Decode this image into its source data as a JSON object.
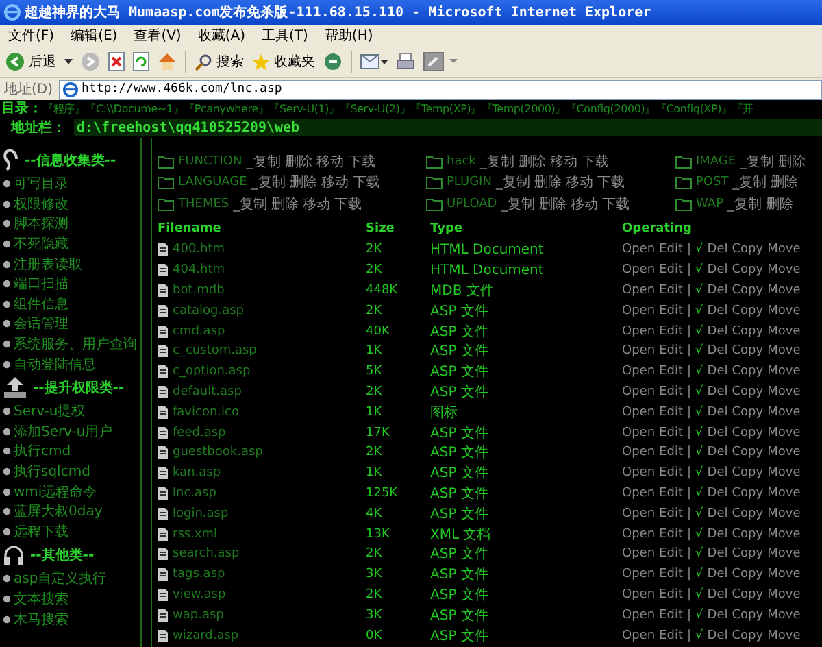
{
  "window": {
    "title": "超越神界的大马 Mumaasp.com发布免杀版-111.68.15.110 - Microsoft Internet Explorer"
  },
  "menu": [
    "文件(F)",
    "编辑(E)",
    "查看(V)",
    "收藏(A)",
    "工具(T)",
    "帮助(H)"
  ],
  "toolbar": {
    "back": "后退",
    "search": "搜索",
    "favorites": "收藏夹"
  },
  "address": {
    "label": "地址(D)",
    "url": "http://www.466k.com/lnc.asp"
  },
  "directory_bar": {
    "label": "目录：",
    "links": [
      "『程序』",
      "『C:\\\\Docume~1』",
      "『Pcanywhere』",
      "『Serv-U(1)』",
      "『Serv-U(2)』",
      "『Temp(XP)』",
      "『Temp(2000)』",
      "『Config(2000)』",
      "『Config(XP)』",
      "『开"
    ]
  },
  "path_bar": {
    "label": "地址栏：",
    "value": "d:\\freehost\\qq410525209\\web"
  },
  "sidebar": [
    {
      "title": "--信息收集类--",
      "items": [
        "可写目录",
        "权限修改",
        "脚本探测",
        "不死隐藏",
        "注册表读取",
        "端口扫描",
        "组件信息",
        "会话管理",
        "系统服务、用户查询",
        "自动登陆信息"
      ]
    },
    {
      "title": "--提升权限类--",
      "items": [
        "Serv-u提权",
        "添加Serv-u用户",
        "执行cmd",
        "执行sqlcmd",
        "wmi远程命令",
        "蓝屏大叔0day",
        "远程下载"
      ]
    },
    {
      "title": "--其他类--",
      "items": [
        "asp自定义执行",
        "文本搜索",
        "木马搜索"
      ]
    }
  ],
  "folders": [
    {
      "name": "FUNCTION",
      "actions": [
        "_复制",
        "删除",
        "移动",
        "下载"
      ]
    },
    {
      "name": "hack",
      "actions": [
        "_复制",
        "删除",
        "移动",
        "下载"
      ]
    },
    {
      "name": "IMAGE",
      "actions": [
        "_复制",
        "删除"
      ]
    },
    {
      "name": "LANGUAGE",
      "actions": [
        "_复制",
        "删除",
        "移动",
        "下载"
      ]
    },
    {
      "name": "PLUGIN",
      "actions": [
        "_复制",
        "删除",
        "移动",
        "下载"
      ]
    },
    {
      "name": "POST",
      "actions": [
        "_复制",
        "删除"
      ]
    },
    {
      "name": "THEMES",
      "actions": [
        "_复制",
        "删除",
        "移动",
        "下载"
      ]
    },
    {
      "name": "UPLOAD",
      "actions": [
        "_复制",
        "删除",
        "移动",
        "下载"
      ]
    },
    {
      "name": "WAP",
      "actions": [
        "_复制",
        "删除"
      ]
    }
  ],
  "table": {
    "columns": [
      "Filename",
      "Size",
      "Type",
      "Operating"
    ],
    "rows": [
      {
        "name": "400.htm",
        "size": "2K",
        "type": "HTML Document",
        "operations": [
          "Open",
          "Edit",
          "|",
          "√",
          "Del",
          "Copy",
          "Move"
        ]
      },
      {
        "name": "404.htm",
        "size": "2K",
        "type": "HTML Document",
        "operations": [
          "Open",
          "Edit",
          "|",
          "√",
          "Del",
          "Copy",
          "Move"
        ]
      },
      {
        "name": "bot.mdb",
        "size": "448K",
        "type": "MDB 文件",
        "operations": [
          "Open",
          "Edit",
          "|",
          "√",
          "Del",
          "Copy",
          "Move"
        ]
      },
      {
        "name": "catalog.asp",
        "size": "2K",
        "type": "ASP 文件",
        "operations": [
          "Open",
          "Edit",
          "|",
          "√",
          "Del",
          "Copy",
          "Move"
        ]
      },
      {
        "name": "cmd.asp",
        "size": "40K",
        "type": "ASP 文件",
        "operations": [
          "Open",
          "Edit",
          "|",
          "√",
          "Del",
          "Copy",
          "Move"
        ]
      },
      {
        "name": "c_custom.asp",
        "size": "1K",
        "type": "ASP 文件",
        "operations": [
          "Open",
          "Edit",
          "|",
          "√",
          "Del",
          "Copy",
          "Move"
        ]
      },
      {
        "name": "c_option.asp",
        "size": "5K",
        "type": "ASP 文件",
        "operations": [
          "Open",
          "Edit",
          "|",
          "√",
          "Del",
          "Copy",
          "Move"
        ]
      },
      {
        "name": "default.asp",
        "size": "2K",
        "type": "ASP 文件",
        "operations": [
          "Open",
          "Edit",
          "|",
          "√",
          "Del",
          "Copy",
          "Move"
        ]
      },
      {
        "name": "favicon.ico",
        "size": "1K",
        "type": "图标",
        "operations": [
          "Open",
          "Edit",
          "|",
          "√",
          "Del",
          "Copy",
          "Move"
        ]
      },
      {
        "name": "feed.asp",
        "size": "17K",
        "type": "ASP 文件",
        "operations": [
          "Open",
          "Edit",
          "|",
          "√",
          "Del",
          "Copy",
          "Move"
        ]
      },
      {
        "name": "guestbook.asp",
        "size": "2K",
        "type": "ASP 文件",
        "operations": [
          "Open",
          "Edit",
          "|",
          "√",
          "Del",
          "Copy",
          "Move"
        ]
      },
      {
        "name": "kan.asp",
        "size": "1K",
        "type": "ASP 文件",
        "operations": [
          "Open",
          "Edit",
          "|",
          "√",
          "Del",
          "Copy",
          "Move"
        ]
      },
      {
        "name": "lnc.asp",
        "size": "125K",
        "type": "ASP 文件",
        "operations": [
          "Open",
          "Edit",
          "|",
          "√",
          "Del",
          "Copy",
          "Move"
        ]
      },
      {
        "name": "login.asp",
        "size": "4K",
        "type": "ASP 文件",
        "operations": [
          "Open",
          "Edit",
          "|",
          "√",
          "Del",
          "Copy",
          "Move"
        ]
      },
      {
        "name": "rss.xml",
        "size": "13K",
        "type": "XML 文档",
        "operations": [
          "Open",
          "Edit",
          "|",
          "√",
          "Del",
          "Copy",
          "Move"
        ]
      },
      {
        "name": "search.asp",
        "size": "2K",
        "type": "ASP 文件",
        "operations": [
          "Open",
          "Edit",
          "|",
          "√",
          "Del",
          "Copy",
          "Move"
        ]
      },
      {
        "name": "tags.asp",
        "size": "3K",
        "type": "ASP 文件",
        "operations": [
          "Open",
          "Edit",
          "|",
          "√",
          "Del",
          "Copy",
          "Move"
        ]
      },
      {
        "name": "view.asp",
        "size": "2K",
        "type": "ASP 文件",
        "operations": [
          "Open",
          "Edit",
          "|",
          "√",
          "Del",
          "Copy",
          "Move"
        ]
      },
      {
        "name": "wap.asp",
        "size": "3K",
        "type": "ASP 文件",
        "operations": [
          "Open",
          "Edit",
          "|",
          "√",
          "Del",
          "Copy",
          "Move"
        ]
      },
      {
        "name": "wizard.asp",
        "size": "0K",
        "type": "ASP 文件",
        "operations": [
          "Open",
          "Edit",
          "|",
          "√",
          "Del",
          "Copy",
          "Move"
        ]
      }
    ]
  }
}
